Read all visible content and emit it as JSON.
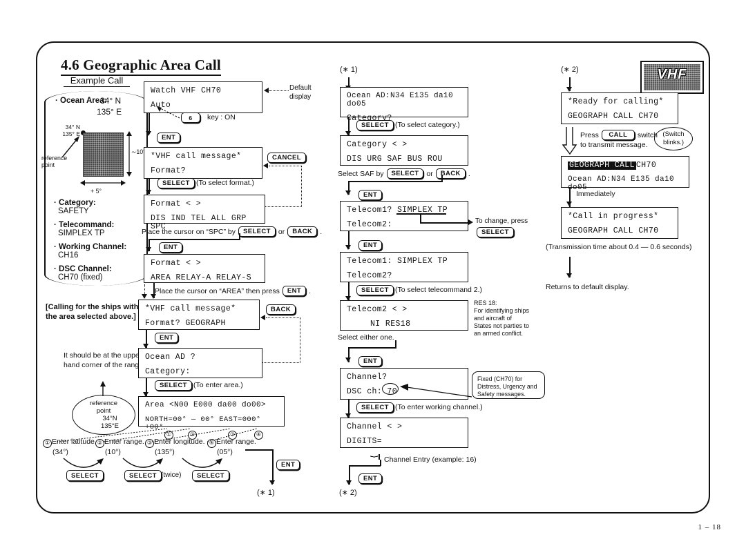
{
  "document": {
    "section_title": "4.6 Geographic Area Call",
    "page_number": "1 – 18",
    "badge": "VHF"
  },
  "example_call": {
    "heading": "Example Call",
    "ocean_area_label": "· Ocean Area:",
    "ocean_area_lat": "34° N",
    "ocean_area_lon": "135° E",
    "map_corner_lat": "34° N",
    "map_corner_lon": "135° E",
    "map_ref_label": "reference\npoint",
    "map_vertical_range": "∼10°",
    "map_horizontal_range": "+ 5°",
    "items": [
      {
        "label": "· Category:",
        "value": "SAFETY"
      },
      {
        "label": "· Telecommand:",
        "value": "SIMPLEX TP"
      },
      {
        "label": "· Working Channel:",
        "value": "CH16"
      },
      {
        "label": "· DSC Channel:",
        "value": "CH70 (fixed)"
      }
    ],
    "calling_note": "[Calling for the ships within the area selected above.]",
    "corner_note": "It should be at the upper left-hand corner of the range.",
    "ref_ellipse": [
      "reference",
      "point",
      "34°N",
      "135°E"
    ]
  },
  "column1": {
    "screens": [
      {
        "name": "watch",
        "line1": "Watch VHF CH70",
        "line2": "Auto"
      },
      {
        "name": "vhf-call-format",
        "line1": "*VHF call message*",
        "line2": "Format?"
      },
      {
        "name": "format-page1",
        "line1": "Format <            >",
        "line2": "DIS IND TEL ALL GRP SPC"
      },
      {
        "name": "format-page2",
        "line1": "Format <            >",
        "line2": "AREA    RELAY-A    RELAY-S"
      },
      {
        "name": "format-geograph",
        "line1": "*VHF call message*",
        "line2": "Format?  GEOGRAPH"
      },
      {
        "name": "ocean-ad",
        "line1": "Ocean AD ?",
        "line2": "Category:"
      },
      {
        "name": "area-entry",
        "line1": "Area <N00 E000 da00 do00>",
        "line2": "NORTH=00° — 00° EAST=000°+00°"
      }
    ],
    "default_display_note": "Default\ndisplay",
    "key6": "6",
    "key6_note": "key : ON",
    "keys": {
      "ent": "ENT",
      "select": "SELECT",
      "back": "BACK",
      "cancel": "CANCEL",
      "call": "CALL"
    },
    "notes": {
      "select_format": "(To select format.)",
      "place_cursor_spc_a": "Place the cursor on “SPC” by",
      "place_cursor_spc_or": "or",
      "place_cursor_spc_end": ".",
      "place_cursor_area": "Place the cursor on “AREA” then press",
      "to_enter_area": "(To enter area.)"
    },
    "entry_steps": [
      {
        "num": "①",
        "text": "Enter latitude.",
        "value": "(34°)",
        "key": "SELECT",
        "suffix": ""
      },
      {
        "num": "②",
        "text": "Enter range.",
        "value": "(10°)",
        "key": "SELECT",
        "suffix": "(twice)"
      },
      {
        "num": "③",
        "text": "Enter longitude.",
        "value": "(135°)",
        "key": "SELECT",
        "suffix": ""
      },
      {
        "num": "④",
        "text": "Enter range.",
        "value": "(05°)",
        "key": "",
        "suffix": ""
      }
    ],
    "markers": {
      "out": "(∗ 1)"
    },
    "field_numbers": [
      "①",
      "②",
      "③",
      "④"
    ]
  },
  "column2": {
    "marker_in": "(∗ 1)",
    "marker_out": "(∗ 2)",
    "screens": [
      {
        "name": "ocean-ad-filled",
        "line1": "Ocean AD:N34 E135 da10 do05",
        "line2": "Category?"
      },
      {
        "name": "category-select",
        "line1": "Category <             >",
        "line2": "DIS  URG  SAF  BUS  ROU"
      },
      {
        "name": "telecom1",
        "line1": "Telecom1?  SIMPLEX TP",
        "line2": "Telecom2:"
      },
      {
        "name": "telecom1-set",
        "line1": "Telecom1:   SIMPLEX TP",
        "line2": "Telecom2?"
      },
      {
        "name": "telecom2-select",
        "line1": "Telecom2 <         >",
        "line2": "NI        RES18"
      },
      {
        "name": "channel",
        "line1": "Channel?",
        "line2": "DSC ch:  70"
      },
      {
        "name": "channel-entry",
        "line1": "Channel <        >",
        "line2": "  DIGITS="
      }
    ],
    "notes": {
      "select_category": "(To select category.)",
      "select_saf_a": "Select SAF by",
      "select_saf_or": "or",
      "select_saf_end": ".",
      "to_change_press": "To change, press",
      "to_change_end": ".",
      "select_telecommand2": "(To select telecommand 2.)",
      "select_either": "Select either one.",
      "res18": "RES 18:\nFor identifying ships\nand aircraft of\nStates not parties to\nan armed conflict.",
      "fixed_ch70": "Fixed (CH70) for\nDistress, Urgency and\nSafety messages.",
      "to_enter_working_channel": "(To enter working channel.)",
      "channel_entry": "Channel Entry (example: 16)"
    },
    "telecom1_value": "SIMPLEX TP",
    "dsc_ch_value": "70",
    "keys": {
      "ent": "ENT",
      "select": "SELECT",
      "back": "BACK"
    }
  },
  "column3": {
    "marker_in": "(∗ 2)",
    "screens": [
      {
        "name": "ready-for-calling",
        "line1": "*Ready for calling*",
        "line2": "GEOGRAPH CALL CH70"
      },
      {
        "name": "geograph-call-sending",
        "line1_hl": "GEOGRAPH CALL",
        "line1_rest": " CH70",
        "line2": "Ocean AD:N34 E135 da10 do05"
      },
      {
        "name": "call-in-progress",
        "line1": "*Call in progress*",
        "line2": "GEOGRAPH CALL CH70"
      }
    ],
    "notes": {
      "press_call_a": "Press",
      "press_call_key": "CALL",
      "press_call_b": "switch",
      "press_call_c": "to transmit message.",
      "switch_blinks": "(Switch\nblinks.)",
      "immediately": "Immediately",
      "transmission_time": "(Transmission time about 0.4 — 0.6 seconds)",
      "returns": "Returns to default display."
    }
  }
}
